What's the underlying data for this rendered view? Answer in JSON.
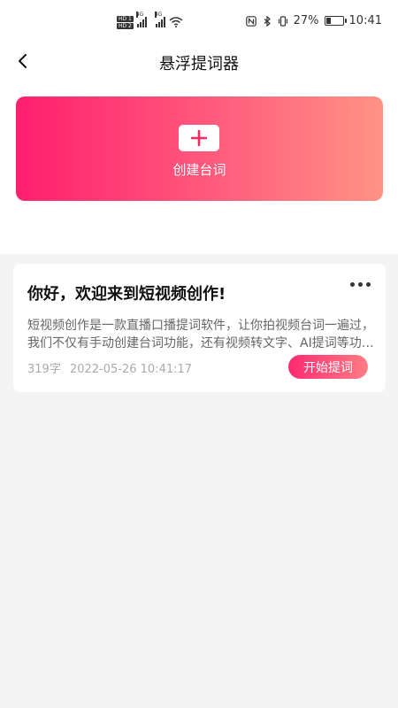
{
  "status_bar": {
    "hd1": "HD 1",
    "hd2": "HD 2",
    "net1": "4G",
    "net2": "4G",
    "battery_percent": "27%",
    "battery_level": 0.27,
    "time": "10:41"
  },
  "header": {
    "title": "悬浮提词器"
  },
  "create": {
    "label": "创建台词"
  },
  "scripts": [
    {
      "title": "你好，欢迎来到短视频创作!",
      "description": "短视频创作是一款直播口播提词软件，让你拍视频台词一遍过，我们不仅有手动创建台词功能，还有视频转文字、AI提词等功能。",
      "word_count": "319字",
      "datetime": "2022-05-26 10:41:17",
      "start_label": "开始提词"
    }
  ],
  "colors": {
    "accent_start": "#ff1f6e",
    "accent_end": "#ff9385",
    "background": "#f4f4f4"
  }
}
